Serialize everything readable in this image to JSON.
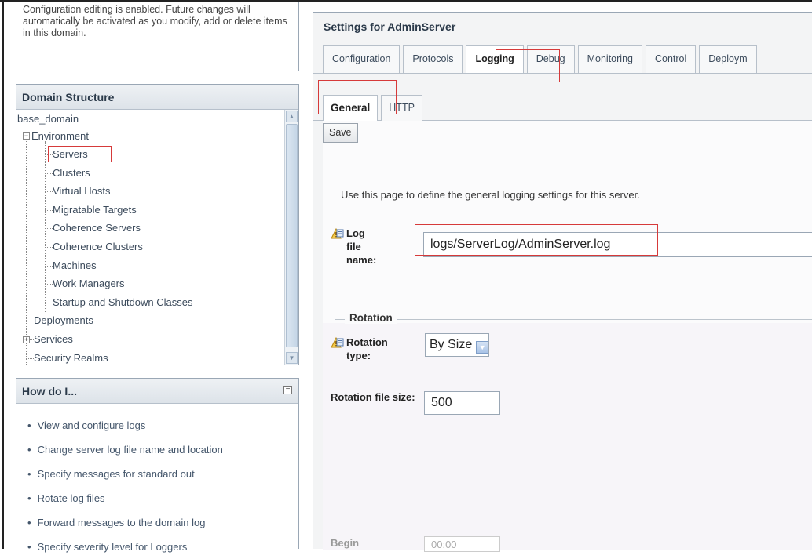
{
  "config_notice": "Configuration editing is enabled. Future changes will automatically be activated as you modify, add or delete items in this domain.",
  "domain_structure": {
    "title": "Domain Structure",
    "root": "base_domain",
    "environment": "Environment",
    "env_items": [
      "Servers",
      "Clusters",
      "Virtual Hosts",
      "Migratable Targets",
      "Coherence Servers",
      "Coherence Clusters",
      "Machines",
      "Work Managers",
      "Startup and Shutdown Classes"
    ],
    "deployments": "Deployments",
    "services": "Services",
    "security_realms": "Security Realms"
  },
  "how_do_i": {
    "title": "How do I...",
    "items": [
      "View and configure logs",
      "Change server log file name and location",
      "Specify messages for standard out",
      "Rotate log files",
      "Forward messages to the domain log",
      "Specify severity level for Loggers"
    ]
  },
  "settings": {
    "title": "Settings for AdminServer",
    "tabs": [
      "Configuration",
      "Protocols",
      "Logging",
      "Debug",
      "Monitoring",
      "Control",
      "Deploym"
    ],
    "subtabs": [
      "General",
      "HTTP"
    ],
    "save_label": "Save",
    "description": "Use this page to define the general logging settings for this server.",
    "log_file_label": "Log file name:",
    "log_file_value": "logs/ServerLog/AdminServer.log",
    "rotation_section": "Rotation",
    "rotation_type_label": "Rotation type:",
    "rotation_type_value": "By Size",
    "rotation_file_size_label": "Rotation file size:",
    "rotation_file_size_value": "500",
    "begin_label": "Begin",
    "begin_value": "00:00"
  },
  "colors": {
    "highlight": "#d63a3a",
    "panel_border": "#9aa7b5"
  }
}
